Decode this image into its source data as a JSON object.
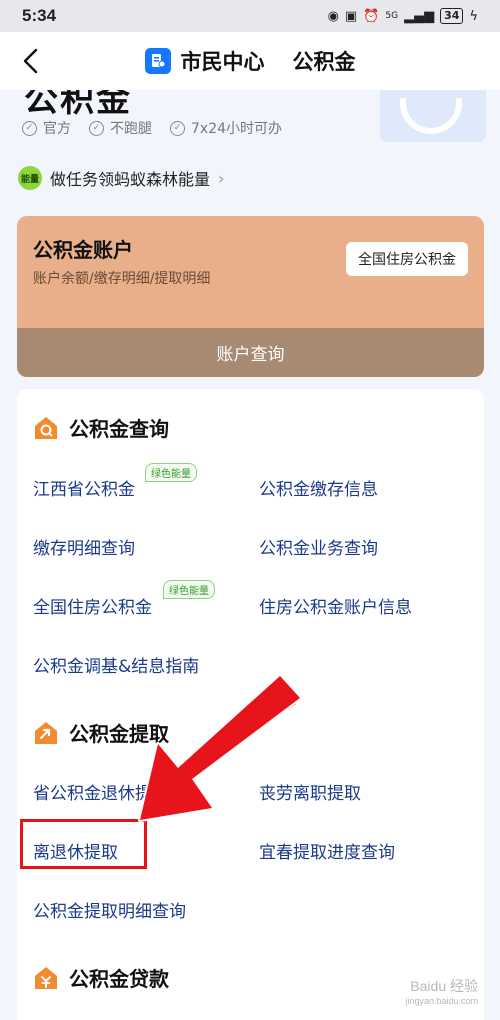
{
  "status_bar": {
    "time": "5:34",
    "battery": "34",
    "network": "5G"
  },
  "nav": {
    "title": "市民中心",
    "subtitle": "公积金"
  },
  "header": {
    "big_title_fragment": "公积金",
    "badges": [
      "官方",
      "不跑腿",
      "7x24小时可办"
    ],
    "energy_icon_label": "能量",
    "energy_text": "做任务领蚂蚁森林能量"
  },
  "account_card": {
    "title": "公积金账户",
    "subtitle": "账户余额/缴存明细/提取明细",
    "nation_button": "全国住房公积金",
    "query_button": "账户查询",
    "bg_color": "#e8af8a",
    "footer_color": "#a88a72"
  },
  "sections": {
    "query": {
      "title": "公积金查询",
      "items": [
        "江西省公积金",
        "公积金缴存信息",
        "缴存明细查询",
        "公积金业务查询",
        "全国住房公积金",
        "住房公积金账户信息",
        "公积金调基&结息指南"
      ],
      "tag": "绿色能量"
    },
    "withdraw": {
      "title": "公积金提取",
      "items": [
        "省公积金退休提取",
        "丧劳离职提取",
        "离退休提取",
        "宜春提取进度查询",
        "公积金提取明细查询"
      ]
    },
    "loan": {
      "title": "公积金贷款"
    }
  },
  "annotation": {
    "highlight_color": "#e8141b"
  },
  "watermark": {
    "main": "Baidu 经验",
    "sub": "jingyan.baidu.com"
  }
}
